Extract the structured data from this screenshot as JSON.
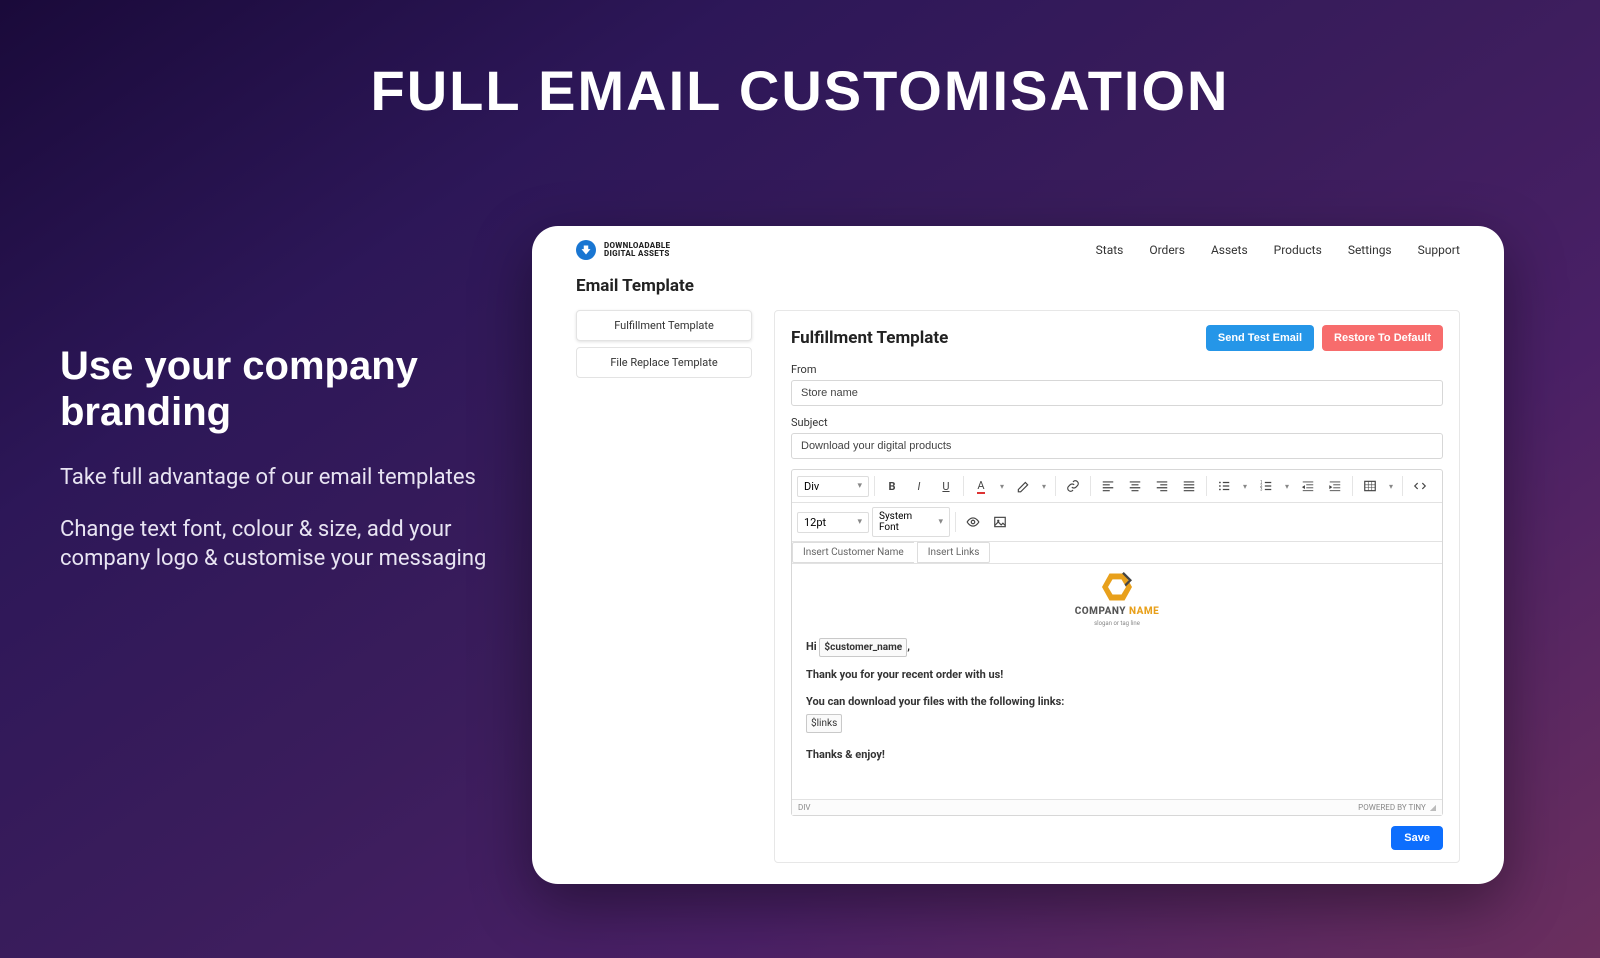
{
  "hero": {
    "title": "FULL EMAIL CUSTOMISATION",
    "subtitle": "Use your company branding",
    "p1": "Take full advantage of our email templates",
    "p2": "Change text font, colour & size, add your company logo & customise your messaging"
  },
  "app": {
    "brand_line1": "DOWNLOADABLE",
    "brand_line2": "DIGITAL ASSETS",
    "nav": [
      "Stats",
      "Orders",
      "Assets",
      "Products",
      "Settings",
      "Support"
    ],
    "section_title": "Email Template",
    "side_tabs": [
      {
        "label": "Fulfillment Template",
        "active": true
      },
      {
        "label": "File Replace Template",
        "active": false
      }
    ],
    "panel_title": "Fulfillment Template",
    "btn_send_test": "Send Test Email",
    "btn_restore": "Restore To Default",
    "from_label": "From",
    "from_value": "Store name",
    "subject_label": "Subject",
    "subject_value": "Download your digital products",
    "toolbar": {
      "block": "Div",
      "font_size": "12pt",
      "font_family": "System Font",
      "insert_customer": "Insert Customer Name",
      "insert_links": "Insert Links"
    },
    "email_body": {
      "company_name_1": "COMPANY",
      "company_name_2": " NAME",
      "tagline": "slogan or tag line",
      "hi": "Hi",
      "var_customer": "$customer_name",
      "comma": ",",
      "line1": "Thank you for your recent order with us!",
      "line2": "You can download your files with the following links:",
      "var_links": "$links",
      "line3": "Thanks & enjoy!"
    },
    "editor_footer_left": "DIV",
    "editor_footer_right": "POWERED BY TINY",
    "btn_save": "Save"
  }
}
